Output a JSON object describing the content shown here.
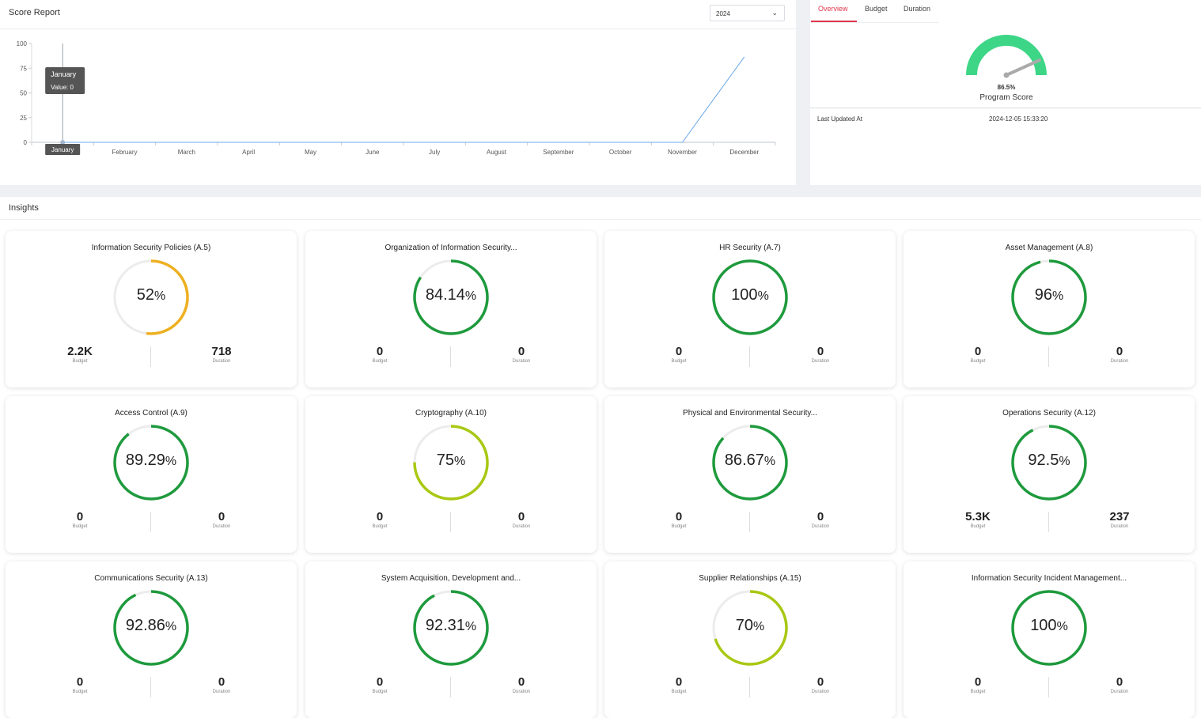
{
  "score_report": {
    "title": "Score Report",
    "year_select": "2024",
    "tooltip": {
      "title": "January",
      "value": "Value: 0"
    },
    "x_tooltip": "January"
  },
  "chart_data": {
    "type": "line",
    "title": "",
    "xlabel": "",
    "ylabel": "",
    "categories": [
      "January",
      "February",
      "March",
      "April",
      "May",
      "June",
      "July",
      "August",
      "September",
      "October",
      "November",
      "December"
    ],
    "series": [
      {
        "values": [
          0,
          0,
          0,
          0,
          0,
          0,
          0,
          0,
          0,
          0,
          0,
          86.5
        ]
      }
    ],
    "y_ticks": [
      0,
      25,
      50,
      75,
      100
    ],
    "ylim": [
      0,
      100
    ],
    "color": "#6aa8e8"
  },
  "program": {
    "tabs": [
      "Overview",
      "Budget",
      "Duration"
    ],
    "active_tab": 0,
    "score_value": "86.5%",
    "score_fraction": 0.865,
    "score_label": "Program Score",
    "last_updated_label": "Last Updated At",
    "last_updated_value": "2024-12-05 15:33:20",
    "gauge_color": "#3dd687",
    "needle_color": "#aaaaaa"
  },
  "insights": {
    "title": "Insights",
    "budget_label": "Budget",
    "duration_label": "Duration",
    "cards": [
      {
        "title": "Information Security Policies (A.5)",
        "score": "52",
        "fraction": 0.52,
        "color": "#eeb021",
        "budget": "2.2K",
        "duration": "718"
      },
      {
        "title": "Organization of Information Security...",
        "score": "84.14",
        "fraction": 0.8414,
        "color": "#1e9a3d",
        "budget": "0",
        "duration": "0"
      },
      {
        "title": "HR Security (A.7)",
        "score": "100",
        "fraction": 1.0,
        "color": "#1e9a3d",
        "budget": "0",
        "duration": "0"
      },
      {
        "title": "Asset Management (A.8)",
        "score": "96",
        "fraction": 0.96,
        "color": "#1e9a3d",
        "budget": "0",
        "duration": "0"
      },
      {
        "title": "Access Control (A.9)",
        "score": "89.29",
        "fraction": 0.8929,
        "color": "#1e9a3d",
        "budget": "0",
        "duration": "0"
      },
      {
        "title": "Cryptography (A.10)",
        "score": "75",
        "fraction": 0.75,
        "color": "#a8c813",
        "budget": "0",
        "duration": "0"
      },
      {
        "title": "Physical and Environmental Security...",
        "score": "86.67",
        "fraction": 0.8667,
        "color": "#1e9a3d",
        "budget": "0",
        "duration": "0"
      },
      {
        "title": "Operations Security (A.12)",
        "score": "92.5",
        "fraction": 0.925,
        "color": "#1e9a3d",
        "budget": "5.3K",
        "duration": "237"
      },
      {
        "title": "Communications Security (A.13)",
        "score": "92.86",
        "fraction": 0.9286,
        "color": "#1e9a3d",
        "budget": "0",
        "duration": "0"
      },
      {
        "title": "System Acquisition, Development and...",
        "score": "92.31",
        "fraction": 0.9231,
        "color": "#1e9a3d",
        "budget": "0",
        "duration": "0"
      },
      {
        "title": "Supplier Relationships (A.15)",
        "score": "70",
        "fraction": 0.7,
        "color": "#a8c813",
        "budget": "0",
        "duration": "0"
      },
      {
        "title": "Information Security Incident Management...",
        "score": "100",
        "fraction": 1.0,
        "color": "#1e9a3d",
        "budget": "0",
        "duration": "0"
      }
    ]
  }
}
